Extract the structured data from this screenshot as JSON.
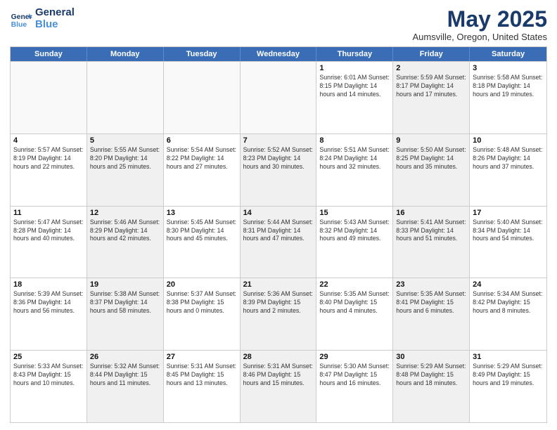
{
  "logo": {
    "line1": "General",
    "line2": "Blue"
  },
  "title": "May 2025",
  "subtitle": "Aumsville, Oregon, United States",
  "header_days": [
    "Sunday",
    "Monday",
    "Tuesday",
    "Wednesday",
    "Thursday",
    "Friday",
    "Saturday"
  ],
  "rows": [
    [
      {
        "day": "",
        "info": "",
        "shaded": false,
        "empty": true
      },
      {
        "day": "",
        "info": "",
        "shaded": false,
        "empty": true
      },
      {
        "day": "",
        "info": "",
        "shaded": false,
        "empty": true
      },
      {
        "day": "",
        "info": "",
        "shaded": false,
        "empty": true
      },
      {
        "day": "1",
        "info": "Sunrise: 6:01 AM\nSunset: 8:15 PM\nDaylight: 14 hours\nand 14 minutes.",
        "shaded": false,
        "empty": false
      },
      {
        "day": "2",
        "info": "Sunrise: 5:59 AM\nSunset: 8:17 PM\nDaylight: 14 hours\nand 17 minutes.",
        "shaded": true,
        "empty": false
      },
      {
        "day": "3",
        "info": "Sunrise: 5:58 AM\nSunset: 8:18 PM\nDaylight: 14 hours\nand 19 minutes.",
        "shaded": false,
        "empty": false
      }
    ],
    [
      {
        "day": "4",
        "info": "Sunrise: 5:57 AM\nSunset: 8:19 PM\nDaylight: 14 hours\nand 22 minutes.",
        "shaded": false,
        "empty": false
      },
      {
        "day": "5",
        "info": "Sunrise: 5:55 AM\nSunset: 8:20 PM\nDaylight: 14 hours\nand 25 minutes.",
        "shaded": true,
        "empty": false
      },
      {
        "day": "6",
        "info": "Sunrise: 5:54 AM\nSunset: 8:22 PM\nDaylight: 14 hours\nand 27 minutes.",
        "shaded": false,
        "empty": false
      },
      {
        "day": "7",
        "info": "Sunrise: 5:52 AM\nSunset: 8:23 PM\nDaylight: 14 hours\nand 30 minutes.",
        "shaded": true,
        "empty": false
      },
      {
        "day": "8",
        "info": "Sunrise: 5:51 AM\nSunset: 8:24 PM\nDaylight: 14 hours\nand 32 minutes.",
        "shaded": false,
        "empty": false
      },
      {
        "day": "9",
        "info": "Sunrise: 5:50 AM\nSunset: 8:25 PM\nDaylight: 14 hours\nand 35 minutes.",
        "shaded": true,
        "empty": false
      },
      {
        "day": "10",
        "info": "Sunrise: 5:48 AM\nSunset: 8:26 PM\nDaylight: 14 hours\nand 37 minutes.",
        "shaded": false,
        "empty": false
      }
    ],
    [
      {
        "day": "11",
        "info": "Sunrise: 5:47 AM\nSunset: 8:28 PM\nDaylight: 14 hours\nand 40 minutes.",
        "shaded": false,
        "empty": false
      },
      {
        "day": "12",
        "info": "Sunrise: 5:46 AM\nSunset: 8:29 PM\nDaylight: 14 hours\nand 42 minutes.",
        "shaded": true,
        "empty": false
      },
      {
        "day": "13",
        "info": "Sunrise: 5:45 AM\nSunset: 8:30 PM\nDaylight: 14 hours\nand 45 minutes.",
        "shaded": false,
        "empty": false
      },
      {
        "day": "14",
        "info": "Sunrise: 5:44 AM\nSunset: 8:31 PM\nDaylight: 14 hours\nand 47 minutes.",
        "shaded": true,
        "empty": false
      },
      {
        "day": "15",
        "info": "Sunrise: 5:43 AM\nSunset: 8:32 PM\nDaylight: 14 hours\nand 49 minutes.",
        "shaded": false,
        "empty": false
      },
      {
        "day": "16",
        "info": "Sunrise: 5:41 AM\nSunset: 8:33 PM\nDaylight: 14 hours\nand 51 minutes.",
        "shaded": true,
        "empty": false
      },
      {
        "day": "17",
        "info": "Sunrise: 5:40 AM\nSunset: 8:34 PM\nDaylight: 14 hours\nand 54 minutes.",
        "shaded": false,
        "empty": false
      }
    ],
    [
      {
        "day": "18",
        "info": "Sunrise: 5:39 AM\nSunset: 8:36 PM\nDaylight: 14 hours\nand 56 minutes.",
        "shaded": false,
        "empty": false
      },
      {
        "day": "19",
        "info": "Sunrise: 5:38 AM\nSunset: 8:37 PM\nDaylight: 14 hours\nand 58 minutes.",
        "shaded": true,
        "empty": false
      },
      {
        "day": "20",
        "info": "Sunrise: 5:37 AM\nSunset: 8:38 PM\nDaylight: 15 hours\nand 0 minutes.",
        "shaded": false,
        "empty": false
      },
      {
        "day": "21",
        "info": "Sunrise: 5:36 AM\nSunset: 8:39 PM\nDaylight: 15 hours\nand 2 minutes.",
        "shaded": true,
        "empty": false
      },
      {
        "day": "22",
        "info": "Sunrise: 5:35 AM\nSunset: 8:40 PM\nDaylight: 15 hours\nand 4 minutes.",
        "shaded": false,
        "empty": false
      },
      {
        "day": "23",
        "info": "Sunrise: 5:35 AM\nSunset: 8:41 PM\nDaylight: 15 hours\nand 6 minutes.",
        "shaded": true,
        "empty": false
      },
      {
        "day": "24",
        "info": "Sunrise: 5:34 AM\nSunset: 8:42 PM\nDaylight: 15 hours\nand 8 minutes.",
        "shaded": false,
        "empty": false
      }
    ],
    [
      {
        "day": "25",
        "info": "Sunrise: 5:33 AM\nSunset: 8:43 PM\nDaylight: 15 hours\nand 10 minutes.",
        "shaded": false,
        "empty": false
      },
      {
        "day": "26",
        "info": "Sunrise: 5:32 AM\nSunset: 8:44 PM\nDaylight: 15 hours\nand 11 minutes.",
        "shaded": true,
        "empty": false
      },
      {
        "day": "27",
        "info": "Sunrise: 5:31 AM\nSunset: 8:45 PM\nDaylight: 15 hours\nand 13 minutes.",
        "shaded": false,
        "empty": false
      },
      {
        "day": "28",
        "info": "Sunrise: 5:31 AM\nSunset: 8:46 PM\nDaylight: 15 hours\nand 15 minutes.",
        "shaded": true,
        "empty": false
      },
      {
        "day": "29",
        "info": "Sunrise: 5:30 AM\nSunset: 8:47 PM\nDaylight: 15 hours\nand 16 minutes.",
        "shaded": false,
        "empty": false
      },
      {
        "day": "30",
        "info": "Sunrise: 5:29 AM\nSunset: 8:48 PM\nDaylight: 15 hours\nand 18 minutes.",
        "shaded": true,
        "empty": false
      },
      {
        "day": "31",
        "info": "Sunrise: 5:29 AM\nSunset: 8:49 PM\nDaylight: 15 hours\nand 19 minutes.",
        "shaded": false,
        "empty": false
      }
    ]
  ]
}
